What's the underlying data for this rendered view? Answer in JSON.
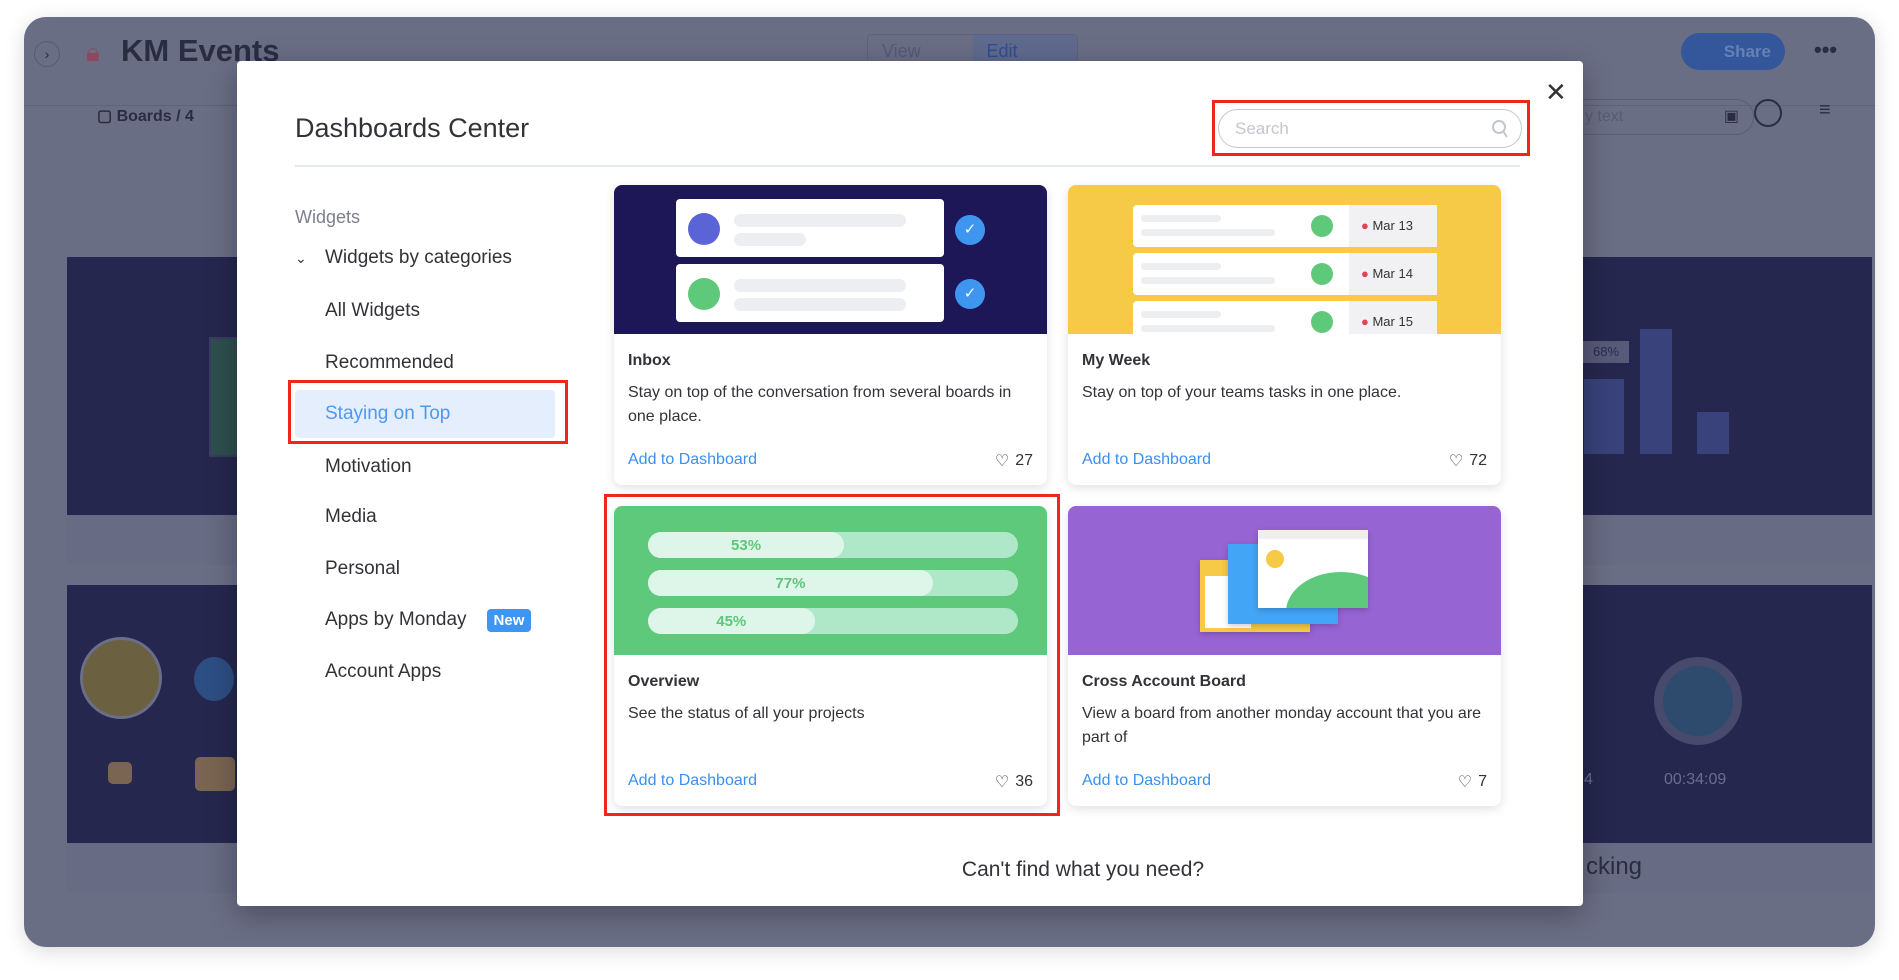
{
  "background": {
    "board_title": "KM Events",
    "view_label": "View",
    "edit_label": "Edit",
    "share_label": "Share",
    "boards_label": "Boards / 4",
    "filter_placeholder": "y text",
    "chart_tooltip": "68%",
    "timer": "00:34:09",
    "partial_label": "cking",
    "partial_num": "4"
  },
  "modal": {
    "title": "Dashboards Center",
    "search_placeholder": "Search",
    "footer": "Can't find what you need?",
    "sidebar": {
      "heading": "Widgets",
      "group": "Widgets by categories",
      "items": [
        {
          "label": "All Widgets"
        },
        {
          "label": "Recommended"
        },
        {
          "label": "Staying on Top",
          "selected": true
        },
        {
          "label": "Motivation"
        },
        {
          "label": "Media"
        },
        {
          "label": "Personal"
        },
        {
          "label": "Apps by Monday",
          "badge": "New"
        },
        {
          "label": "Account Apps"
        }
      ]
    },
    "cards": [
      {
        "title": "Inbox",
        "desc": "Stay on top of the conversation from several boards in one place.",
        "action": "Add to Dashboard",
        "likes": "27",
        "color": "#1d1657"
      },
      {
        "title": "My Week",
        "desc": "Stay on top of your teams tasks in one place.",
        "action": "Add to Dashboard",
        "likes": "72",
        "color": "#f6ca46",
        "dates": [
          "Mar 13",
          "Mar 14",
          "Mar 15"
        ]
      },
      {
        "title": "Overview",
        "desc": "See the status of all your projects",
        "action": "Add to Dashboard",
        "likes": "36",
        "color": "#5ec97a",
        "progress": [
          {
            "label": "53%",
            "value": 53
          },
          {
            "label": "77%",
            "value": 77
          },
          {
            "label": "45%",
            "value": 45
          }
        ]
      },
      {
        "title": "Cross Account Board",
        "desc": "View a board from another monday account that you are part of",
        "action": "Add to Dashboard",
        "likes": "7",
        "color": "#9764d4"
      }
    ]
  },
  "colors": {
    "accent": "#3b8ff0",
    "highlight": "#f0261b",
    "selected_bg": "#e4eefc"
  }
}
